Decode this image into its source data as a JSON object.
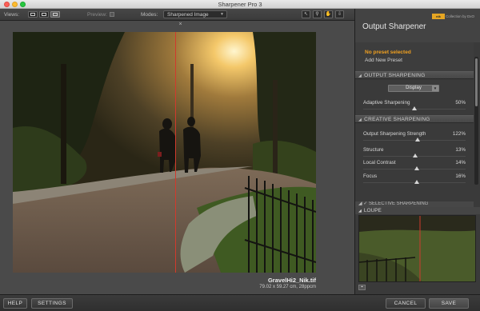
{
  "window": {
    "title": "Sharpener Pro 3"
  },
  "toolbar": {
    "views_label": "Views:",
    "preview_label": "Preview:",
    "modes_label": "Modes:",
    "mode_value": "Sharpened Image",
    "view_buttons": [
      "single-view-icon",
      "split-view-icon",
      "side-by-side-icon"
    ],
    "tools": [
      "pointer-icon",
      "zoom-icon",
      "hand-icon",
      "save-icon"
    ]
  },
  "image": {
    "filename": "GravelHi2_Nik.tif",
    "dimensions": "79.02 x 59.27 cm, 28ppcm",
    "split_color": "#d03a2d"
  },
  "panel": {
    "title": "Output Sharpener",
    "brand_text": "Collection by DxO",
    "brand_badge": "nik",
    "preset": {
      "status": "No preset selected",
      "add": "Add New Preset"
    },
    "output_sharpening": {
      "heading": "OUTPUT SHARPENING",
      "select_value": "Display",
      "sliders": [
        {
          "label": "Adaptive Sharpening",
          "value": "50%",
          "level": 0.5
        }
      ]
    },
    "creative_sharpening": {
      "heading": "CREATIVE SHARPENING",
      "sliders": [
        {
          "label": "Output Sharpening Strength",
          "value": "122%",
          "level": 0.53
        },
        {
          "label": "Structure",
          "value": "13%",
          "level": 0.51
        },
        {
          "label": "Local Contrast",
          "value": "14%",
          "level": 0.52
        },
        {
          "label": "Focus",
          "value": "16%",
          "level": 0.52
        }
      ]
    },
    "selective_sharpening": {
      "heading": "SELECTIVE SHARPENING"
    },
    "loupe": {
      "heading": "LOUPE"
    }
  },
  "footer": {
    "help": "HELP",
    "settings": "SETTINGS",
    "cancel": "CANCEL",
    "save": "SAVE"
  },
  "colors": {
    "accent": "#f0a020",
    "panel": "#3a3a3a",
    "canvas": "#4a4a4a"
  }
}
